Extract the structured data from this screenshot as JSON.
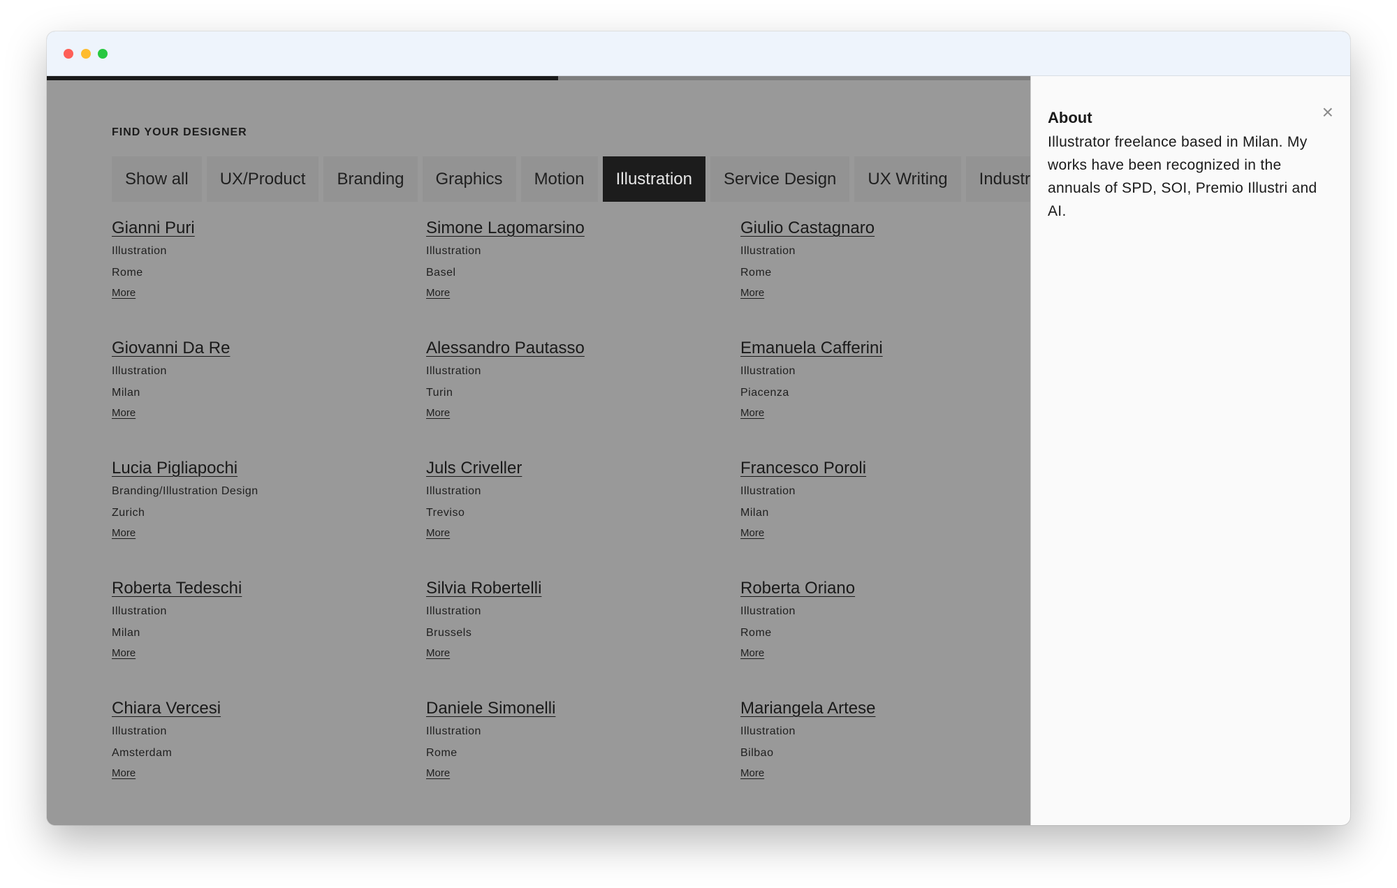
{
  "page": {
    "heading": "FIND YOUR DESIGNER",
    "progress": 0.52
  },
  "filters": [
    {
      "label": "Show all",
      "active": false
    },
    {
      "label": "UX/Product",
      "active": false
    },
    {
      "label": "Branding",
      "active": false
    },
    {
      "label": "Graphics",
      "active": false
    },
    {
      "label": "Motion",
      "active": false
    },
    {
      "label": "Illustration",
      "active": true
    },
    {
      "label": "Service Design",
      "active": false
    },
    {
      "label": "UX Writing",
      "active": false
    },
    {
      "label": "Industrial",
      "active": false
    }
  ],
  "designers": [
    {
      "name": "Gianni Puri",
      "category": "Illustration",
      "city": "Rome",
      "more": "More"
    },
    {
      "name": "Simone Lagomarsino",
      "category": "Illustration",
      "city": "Basel",
      "more": "More"
    },
    {
      "name": "Giulio Castagnaro",
      "category": "Illustration",
      "city": "Rome",
      "more": "More"
    },
    {
      "name": "Giovanni Da Re",
      "category": "Illustration",
      "city": "Milan",
      "more": "More"
    },
    {
      "name": "Alessandro Pautasso",
      "category": "Illustration",
      "city": "Turin",
      "more": "More"
    },
    {
      "name": "Emanuela Cafferini",
      "category": "Illustration",
      "city": "Piacenza",
      "more": "More"
    },
    {
      "name": "Lucia Pigliapochi",
      "category": "Branding/Illustration Design",
      "city": "Zurich",
      "more": "More"
    },
    {
      "name": "Juls Criveller",
      "category": "Illustration",
      "city": "Treviso",
      "more": "More"
    },
    {
      "name": "Francesco Poroli",
      "category": "Illustration",
      "city": "Milan",
      "more": "More"
    },
    {
      "name": "Roberta Tedeschi",
      "category": "Illustration",
      "city": "Milan",
      "more": "More"
    },
    {
      "name": "Silvia Robertelli",
      "category": "Illustration",
      "city": "Brussels",
      "more": "More"
    },
    {
      "name": "Roberta Oriano",
      "category": "Illustration",
      "city": "Rome",
      "more": "More"
    },
    {
      "name": "Chiara Vercesi",
      "category": "Illustration",
      "city": "Amsterdam",
      "more": "More"
    },
    {
      "name": "Daniele Simonelli",
      "category": "Illustration",
      "city": "Rome",
      "more": "More"
    },
    {
      "name": "Mariangela Artese",
      "category": "Illustration",
      "city": "Bilbao",
      "more": "More"
    }
  ],
  "panel": {
    "title": "About",
    "text": "Illustrator freelance based in Milan. My works have been recognized in the annuals of SPD, SOI, Premio Illustri and AI.",
    "close_glyph": "×"
  },
  "colors": {
    "overlay_bg": "#999999",
    "active_tab": "#1c1c1c",
    "panel_bg": "#fafafa",
    "titlebar_bg": "#eef4fc"
  }
}
